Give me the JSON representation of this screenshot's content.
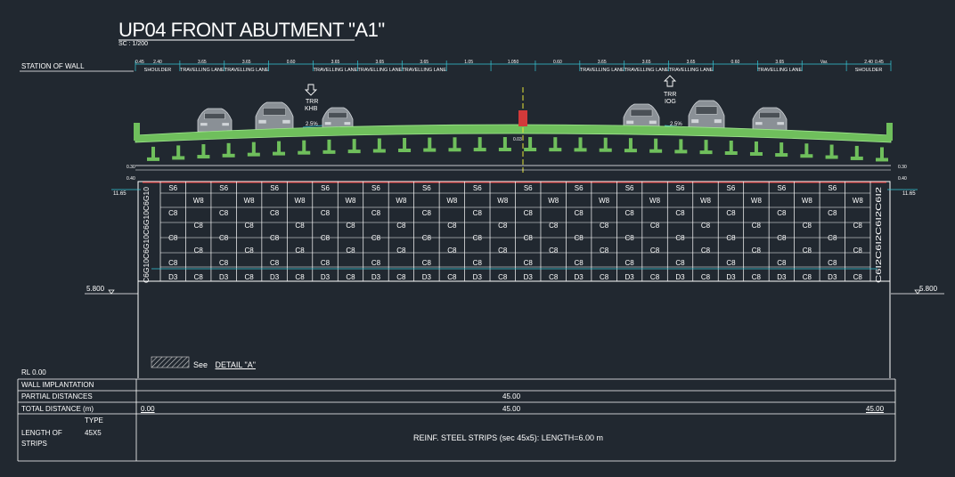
{
  "drawing": {
    "title": "UP04 FRONT ABUTMENT \"A1\"",
    "scale": "SC : 1/200",
    "station_label": "STATION OF WALL"
  },
  "road_section": {
    "lanes": [
      {
        "dim": "2.40",
        "label": "SHOULDER"
      },
      {
        "dim": "3.65",
        "label": "TRAVELLING LANE"
      },
      {
        "dim": "3.65",
        "label": "TRAVELLING LANE"
      },
      {
        "dim": "0.60",
        "label": ""
      },
      {
        "dim": "3.65",
        "label": "TRAVELLING LANE"
      },
      {
        "dim": "3.65",
        "label": "TRAVELLING LANE"
      },
      {
        "dim": "3.65",
        "label": "TRAVELLING LANE"
      },
      {
        "dim": "1.05",
        "label": ""
      },
      {
        "dim": "1.050",
        "label": ""
      },
      {
        "dim": "0.60",
        "label": ""
      },
      {
        "dim": "3.65",
        "label": "TRAVELLING LANE"
      },
      {
        "dim": "3.65",
        "label": "TRAVELLING LANE"
      },
      {
        "dim": "3.65",
        "label": "TRAVELLING LANE"
      },
      {
        "dim": "0.60",
        "label": ""
      },
      {
        "dim": "3.65",
        "label": "TRAVELLING LANE"
      },
      {
        "dim": "Var.",
        "label": ""
      },
      {
        "dim": "2.40",
        "label": "SHOULDER"
      }
    ],
    "edge_dims": {
      "left": "0.45",
      "right": "0.45"
    },
    "arrow_left": {
      "line1": "TRR",
      "line2": "KHB"
    },
    "arrow_right": {
      "line1": "TRR",
      "line2": "IOG"
    },
    "slope_left": "2.5%",
    "slope_right": "2.5%",
    "center_dim": "0.03",
    "left_side_dims": [
      "0.30",
      "0.40",
      "11.65"
    ],
    "right_side_dims": [
      "0.30",
      "0.40",
      "11.65"
    ]
  },
  "wall": {
    "columns": 29,
    "row_top": [
      "S6",
      "W8"
    ],
    "row_mid": [
      "C8",
      "C8",
      "C8"
    ],
    "row_bottom": [
      "D3",
      "C8"
    ],
    "left_side_labels": "C6G10C6G10C6G10C6G10",
    "right_side_labels": "C6I2C6I2C6I2C6I2",
    "level_left": "5.800",
    "level_right": "5.800"
  },
  "legend": {
    "text": "See",
    "detail": "DETAIL \"A\""
  },
  "table": {
    "rl": "RL 0.00",
    "rows": {
      "implantation": "WALL IMPLANTATION",
      "partial": "PARTIAL DISTANCES",
      "total": "TOTAL DISTANCE (m)",
      "strips": "LENGTH OF",
      "strips2": "STRIPS",
      "type": "TYPE",
      "type_val": "45X5"
    },
    "partial_value": "45.00",
    "total_start": "0.00",
    "total_mid": "45.00",
    "total_end": "45.00",
    "strip_note": "REINF. STEEL STRIPS (sec 45x5): LENGTH=6.00 m"
  },
  "colors": {
    "background": "#212830",
    "deck": "#7fd36a",
    "panel_line": "#ffffff",
    "cyan": "#36c6d6",
    "red": "#d23a3a",
    "yellow": "#e5e538"
  }
}
